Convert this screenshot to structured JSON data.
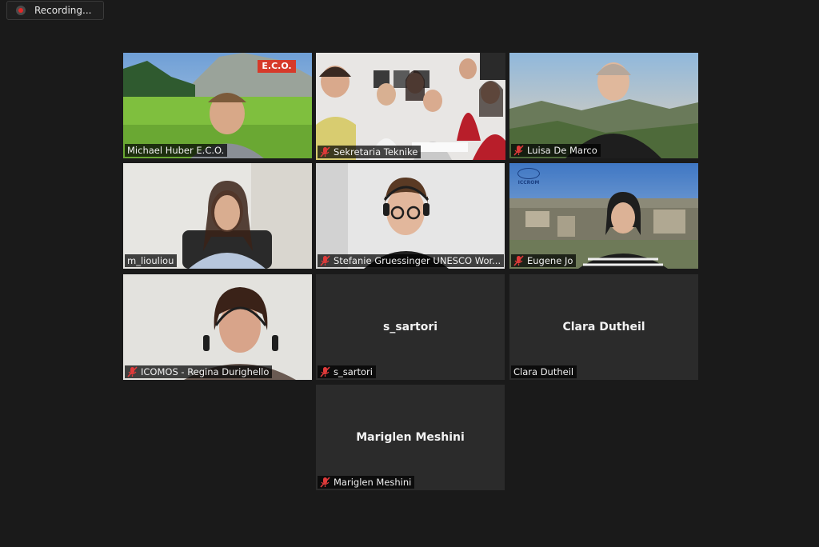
{
  "recording": {
    "label": "Recording..."
  },
  "participants": [
    {
      "id": "p1",
      "name": "Michael Huber E.C.O.",
      "muted": false,
      "video": true,
      "logo_text": "E.C.O."
    },
    {
      "id": "p2",
      "name": "Sekretaria Teknike",
      "muted": true,
      "video": true,
      "active_speaker": true
    },
    {
      "id": "p3",
      "name": "Luisa De Marco",
      "muted": true,
      "video": true
    },
    {
      "id": "p4",
      "name": "m_liouliou",
      "muted": false,
      "video": true
    },
    {
      "id": "p5",
      "name": "Stefanie Gruessinger UNESCO Wor...",
      "muted": true,
      "video": true
    },
    {
      "id": "p6",
      "name": "Eugene Jo",
      "muted": true,
      "video": true,
      "logo_text": "ICCROM"
    },
    {
      "id": "p7",
      "name": "ICOMOS - Regina Durighello",
      "muted": true,
      "video": true
    },
    {
      "id": "p8",
      "name": "s_sartori",
      "muted": true,
      "video": false,
      "display_name": "s_sartori"
    },
    {
      "id": "p9",
      "name": "Clara Dutheil",
      "muted": false,
      "video": false,
      "display_name": "Clara Dutheil"
    },
    {
      "id": "p10",
      "name": "Mariglen Meshini",
      "muted": true,
      "video": false,
      "display_name": "Mariglen Meshini"
    }
  ],
  "colors": {
    "background": "#1a1a1a",
    "tile": "#2b2b2b",
    "active_border": "#d8e45a",
    "muted_icon": "#e03a3a"
  }
}
